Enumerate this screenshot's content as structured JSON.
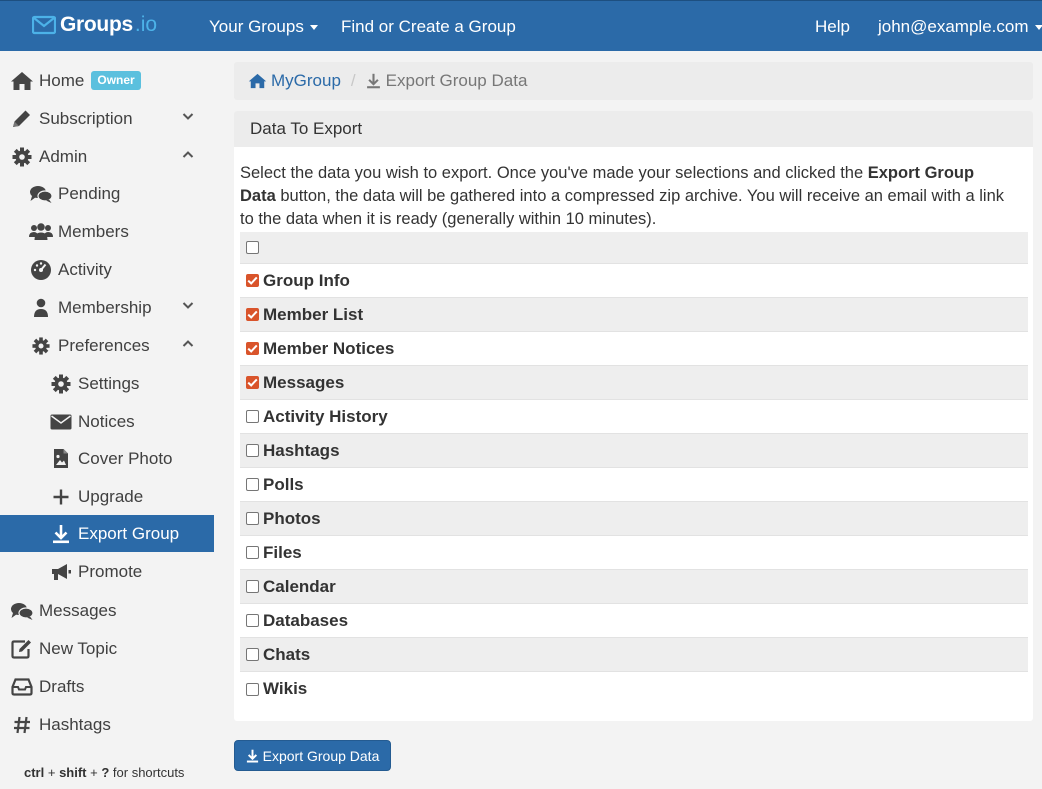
{
  "navbar": {
    "brand_name": "Groups",
    "brand_tld": ".io",
    "your_groups": "Your Groups",
    "find_create": "Find or Create a Group",
    "help": "Help",
    "user_email": "john@example.com"
  },
  "sidebar": {
    "home": "Home",
    "owner_badge": "Owner",
    "subscription": "Subscription",
    "admin": "Admin",
    "pending": "Pending",
    "members": "Members",
    "activity": "Activity",
    "membership": "Membership",
    "preferences": "Preferences",
    "settings": "Settings",
    "notices": "Notices",
    "cover_photo": "Cover Photo",
    "upgrade": "Upgrade",
    "export_group": "Export Group",
    "promote": "Promote",
    "messages": "Messages",
    "new_topic": "New Topic",
    "drafts": "Drafts",
    "hashtags": "Hashtags",
    "shortcut_ctrl": "ctrl",
    "shortcut_plus1": " + ",
    "shortcut_shift": "shift",
    "shortcut_plus2": " + ",
    "shortcut_q": "?",
    "shortcut_tail": " for shortcuts"
  },
  "breadcrumb": {
    "group": "MyGroup",
    "separator": "/",
    "current": "Export Group Data"
  },
  "panel": {
    "title": "Data To Export",
    "intro_before": "Select the data you wish to export. Once you've made your selections and clicked the ",
    "intro_bold": "Export Group Data",
    "intro_after": " button, the data will be gathered into a compressed zip archive. You will receive an email with a link to the data when it is ready (generally within 10 minutes).",
    "select_all_checked": false,
    "items": [
      {
        "label": "Group Info",
        "checked": true
      },
      {
        "label": "Member List",
        "checked": true
      },
      {
        "label": "Member Notices",
        "checked": true
      },
      {
        "label": "Messages",
        "checked": true
      },
      {
        "label": "Activity History",
        "checked": false
      },
      {
        "label": "Hashtags",
        "checked": false
      },
      {
        "label": "Polls",
        "checked": false
      },
      {
        "label": "Photos",
        "checked": false
      },
      {
        "label": "Files",
        "checked": false
      },
      {
        "label": "Calendar",
        "checked": false
      },
      {
        "label": "Databases",
        "checked": false
      },
      {
        "label": "Chats",
        "checked": false
      },
      {
        "label": "Wikis",
        "checked": false
      }
    ]
  },
  "export_button": "Export Group Data",
  "colors": {
    "primary": "#2b6aa8",
    "accent_checkbox": "#d9542b",
    "badge": "#5bc0de",
    "brand_tld": "#4cb2e8"
  }
}
